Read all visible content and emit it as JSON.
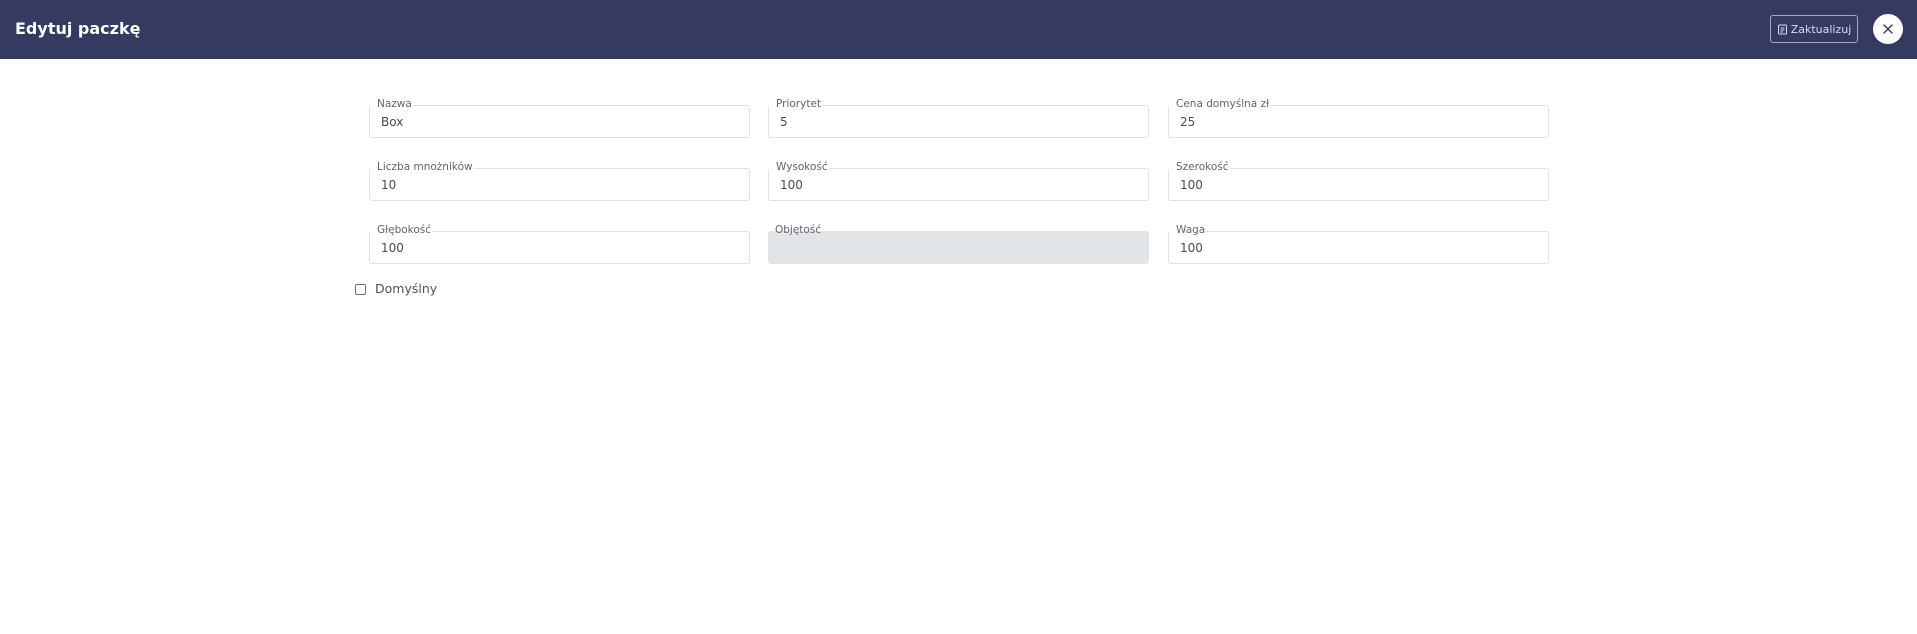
{
  "header": {
    "title": "Edytuj paczkę",
    "update_label": "Zaktualizuj",
    "update_icon": "save-icon",
    "close_icon": "close-icon",
    "background_color": "#363960"
  },
  "form": {
    "nazwa": {
      "label": "Nazwa",
      "value": "Box",
      "required": true
    },
    "priorytet": {
      "label": "Priorytet",
      "value": "5",
      "required": true
    },
    "cena": {
      "label": "Cena domyślna zł",
      "value": "25",
      "required": true
    },
    "liczba_mnoznikow": {
      "label": "Liczba mnożników",
      "value": "10",
      "required": true
    },
    "wysokosc": {
      "label": "Wysokość",
      "value": "100",
      "required": true
    },
    "szerokosc": {
      "label": "Szerokość",
      "value": "100",
      "required": true
    },
    "glebokosc": {
      "label": "Głębokość",
      "value": "100",
      "required": true
    },
    "objetosc": {
      "label": "Objętość",
      "value": "",
      "required": false,
      "disabled": true
    },
    "waga": {
      "label": "Waga",
      "value": "100",
      "required": true
    },
    "domyslny": {
      "label": "Domyślny",
      "checked": false
    },
    "required_marker": "*"
  }
}
